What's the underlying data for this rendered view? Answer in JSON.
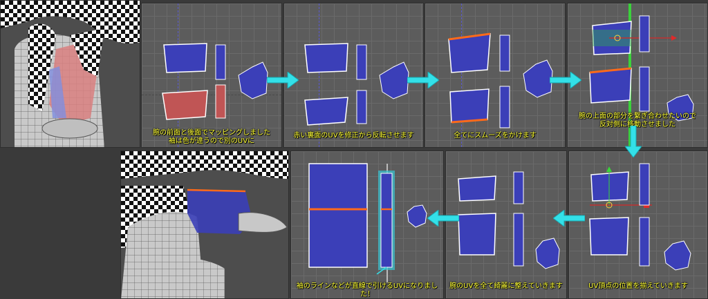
{
  "captions": {
    "step1": "腕の前面と後面でマッピングしました\n袖は色が違うので別のUVに",
    "step2": "赤い裏面のUVを修正から反転させます",
    "step3": "全てにスムーズをかけます",
    "step4": "腕の上面の部分を繋ぎ合わせたいので\n反対側に移動させました",
    "step5": "UV頂点の位置を揃えていきます",
    "step6": "腕のUVを全て綺麗に整えていきます",
    "step7": "袖のラインなどが直線で引けるUVになりました！"
  },
  "colors": {
    "uv_fill": "#3b3fb8",
    "uv_line": "#ffffff",
    "uv_back": "#c05555",
    "seam": "#ff6a1a",
    "arrow": "#33e0e8",
    "caption": "#ffff33",
    "highlight": "#37c6d6"
  },
  "icons": {
    "flow_arrow": "right-arrow-icon",
    "down_arrow": "down-arrow-icon",
    "left_arrow": "left-arrow-icon",
    "manipulator": "move-manipulator-icon"
  }
}
